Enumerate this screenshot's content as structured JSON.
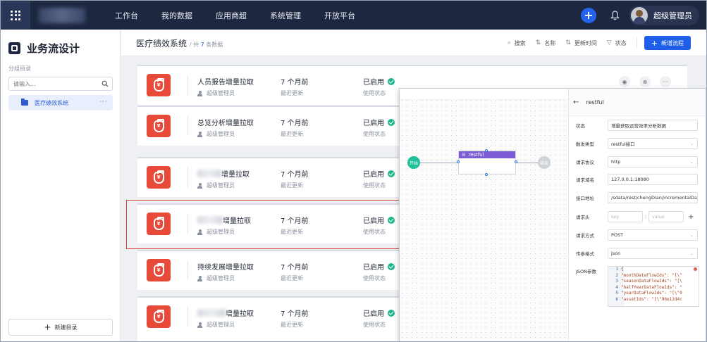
{
  "topbar": {
    "nav": [
      "工作台",
      "我的数据",
      "应用商超",
      "系统管理",
      "开放平台"
    ],
    "user_name": "超级管理员"
  },
  "sidebar": {
    "title": "业务流设计",
    "section_label": "分组目录",
    "search_placeholder": "请输入...",
    "folder_label": "医疗绩效系统",
    "folder_more": "···",
    "new_dir_label": "新建目录"
  },
  "header": {
    "title": "医疗绩效系统",
    "count_prefix": "/ 共",
    "count_num": "7",
    "count_suffix": "条数据",
    "tools": [
      "搜索",
      "名称",
      "更新时间",
      "状态"
    ],
    "add_label": "新增流程"
  },
  "rows": [
    {
      "name": "人员报告增量拉取",
      "owner": "超级管理员",
      "time": "7 个月前",
      "time_label": "最近更新",
      "status": "已启用",
      "status_label": "使用状态"
    },
    {
      "name": "总览分析增量拉取",
      "owner": "超级管理员",
      "time": "7 个月前",
      "time_label": "最近更新",
      "status": "已启用",
      "status_label": "使用状态"
    },
    {
      "name": "增量拉取",
      "owner": "超级管理员",
      "time": "7 个月前",
      "time_label": "最近更新",
      "status": "已启用",
      "status_label": "使用状态"
    },
    {
      "name": "增量拉取",
      "owner": "超级管理员",
      "time": "7 个月前",
      "time_label": "最近更新",
      "status": "已启用",
      "status_label": "使用状态"
    },
    {
      "name": "持续发展增量拉取",
      "owner": "超级管理员",
      "time": "7 个月前",
      "time_label": "最近更新",
      "status": "已启用",
      "status_label": "使用状态"
    },
    {
      "name": "增量拉取",
      "owner": "超级管理员",
      "time": "7 个月前",
      "time_label": "最近更新",
      "status": "已启用",
      "status_label": "使用状态"
    }
  ],
  "flow": {
    "start_label": "开始",
    "end_label": "结束",
    "task_label": "restful"
  },
  "props": {
    "title": "restful",
    "fields": [
      {
        "label": "状态",
        "value": "增量获取运营效率分析数据"
      },
      {
        "label": "触发类型",
        "value": "restful接口"
      },
      {
        "label": "请求协议",
        "value": "http"
      },
      {
        "label": "请求域名",
        "value": "127.0.0.1:18080"
      },
      {
        "label": "接口地址",
        "value": "/sdata/rest/chengDian/incrementalDa"
      },
      {
        "label": "请求头",
        "key_placeholder": "key",
        "value_placeholder": "value"
      },
      {
        "label": "请求方式",
        "value": "POST"
      },
      {
        "label": "传参格式",
        "value": "json"
      },
      {
        "label": "JSON参数"
      }
    ],
    "code_lines": [
      {
        "ln": "1",
        "text": "{"
      },
      {
        "ln": "2",
        "text": "  \"monthDataFlowIds\": \"[\\\""
      },
      {
        "ln": "3",
        "text": "  \"seasonDataFlowIds\": \"[\\"
      },
      {
        "ln": "4",
        "text": "  \"halfYearDataFlowIds\": \""
      },
      {
        "ln": "5",
        "text": "  \"yearDataFlowIds\": \"[\\\"9"
      },
      {
        "ln": "6",
        "text": "  \"assetIds\": \"[\\\"96e12d4c"
      }
    ]
  },
  "colors": {
    "accent": "#1e5eea",
    "topbar": "#1d2740",
    "icon_red": "#e84a3a",
    "status_green": "#1fb58a",
    "highlight_red": "#d9403a"
  }
}
